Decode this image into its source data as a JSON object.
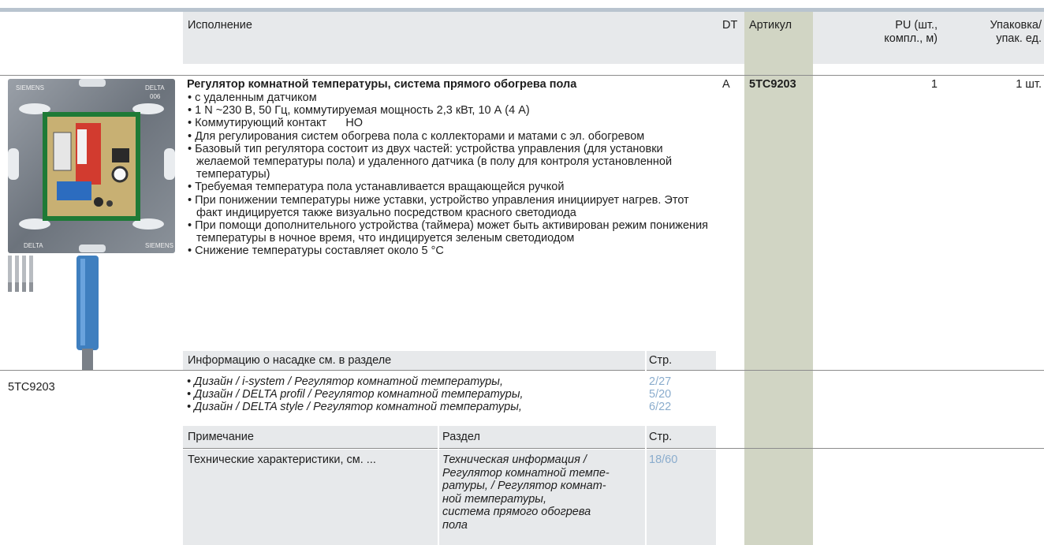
{
  "header": {
    "col_execution": "Исполнение",
    "col_dt": "DT",
    "col_article": "Артикул",
    "col_pu_1": "PU (шт.,",
    "col_pu_2": "компл., м)",
    "col_pack_1": "Упаковка/",
    "col_pack_2": "упак. ед."
  },
  "product": {
    "title": "Регулятор комнатной температуры, система прямого обогрева пола",
    "dt": "A",
    "article": "5TC9203",
    "pu": "1",
    "pack": "1 шт.",
    "image_caption": "5TC9203",
    "bullets": [
      "с удаленным датчиком",
      "1 N ~230 В, 50 Гц, коммутируемая мощность 2,3 кВт, 10 А (4 А)",
      "Коммутирующий контакт      НО",
      "Для регулирования систем обогрева пола с коллекторами и матами с эл. обогревом",
      "Базовый тип регулятора состоит из двух частей: устройства управления (для установки желаемой температуры пола) и удаленного датчика (в полу для контроля установленной температуры)",
      "Требуемая температура пола устанавливается вращающейся ручкой",
      "При понижении температуры ниже уставки, устройство управления иници­ирует нагрев. Этот факт индицируется также визуально посредством красно­го светодиода",
      "При помощи дополнительного устройства (таймера)  может быть активиро­ван режим понижения температуры в ночное время, что индицируется зеле­ным светодиодом",
      "Снижение температуры составляет около 5 °C"
    ]
  },
  "design_info": {
    "header": "Информацию о насадке см. в разделе",
    "page_header": "Стр.",
    "items": [
      {
        "text": "Дизайн / i-system / Регулятор комнатной температуры,",
        "page": "2/27"
      },
      {
        "text": "Дизайн / DELTA profil / Регулятор комнатной температуры,",
        "page": "5/20"
      },
      {
        "text": "Дизайн / DELTA style / Регулятор комнатной температуры,",
        "page": "6/22"
      }
    ]
  },
  "notes": {
    "col_note": "Примечание",
    "col_section": "Раздел",
    "col_page": "Стр.",
    "row_note": "Технические характеристики, см. ...",
    "row_section_lines": [
      "Техническая информация /",
      "Регулятор комнатной темпе-",
      "ратуры, / Регулятор комнат-",
      "ной температуры,",
      "система прямого обогрева",
      "пола"
    ],
    "row_page": "18/60"
  },
  "images": {
    "thermostat_brand_1": "SIEMENS",
    "thermostat_brand_2": "DELTA",
    "thermostat_code": "006"
  }
}
